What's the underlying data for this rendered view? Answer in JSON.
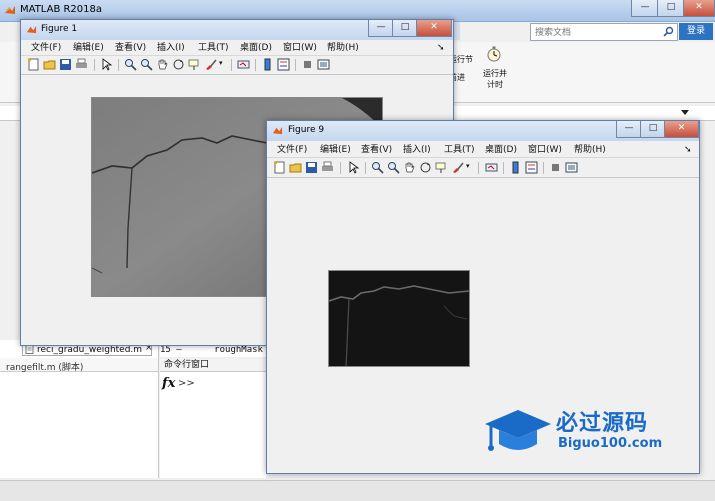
{
  "matlab": {
    "title": "MATLAB R2018a",
    "window_controls": [
      "—",
      "□",
      "✕"
    ],
    "search_placeholder": "搜索文档",
    "sign_in": "登录",
    "toolstrip": {
      "run_section": "运行节",
      "advance": "前进",
      "run_and_time": "运行并\n计时"
    },
    "file_tab": "reci_gradu_weighted.m",
    "file_tab_close": "×",
    "file_info": "rangefilt.m  (脚本)",
    "code_line": "15 —      roughMask =",
    "command_window_title": "命令行窗口",
    "prompt_fx": "fx",
    "prompt": ">>"
  },
  "figure1": {
    "title": "Figure 1",
    "menu": [
      "文件(F)",
      "编辑(E)",
      "查看(V)",
      "插入(I)",
      "工具(T)",
      "桌面(D)",
      "窗口(W)",
      "帮助(H)"
    ],
    "window_controls": [
      "—",
      "□",
      "✕"
    ]
  },
  "figure9": {
    "title": "Figure 9",
    "menu": [
      "文件(F)",
      "编辑(E)",
      "查看(V)",
      "插入(I)",
      "工具(T)",
      "桌面(D)",
      "窗口(W)",
      "帮助(H)"
    ],
    "window_controls": [
      "—",
      "□",
      "✕"
    ]
  },
  "watermark": {
    "text": "必过源码",
    "url": "Biguo100.com"
  },
  "colors": {
    "title_gradient_top": "#dfe9f6",
    "accent_blue": "#2c73c4",
    "watermark_blue": "#1a6bc8"
  }
}
